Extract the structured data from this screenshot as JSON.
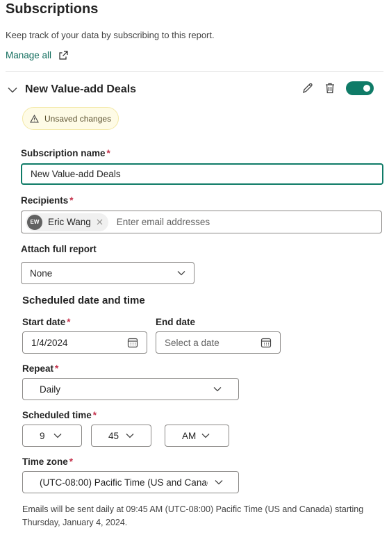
{
  "panel": {
    "title": "Subscriptions",
    "description": "Keep track of your data by subscribing to this report.",
    "manage_all": "Manage all"
  },
  "subscription": {
    "name_header": "New Value-add Deals",
    "enabled": true,
    "unsaved_badge": "Unsaved changes",
    "name_label": "Subscription name",
    "name_value": "New Value-add Deals",
    "recipients_label": "Recipients",
    "recipient": {
      "initials": "EW",
      "name": "Eric Wang"
    },
    "recipients_placeholder": "Enter email addresses",
    "attach_label": "Attach full report",
    "attach_value": "None",
    "schedule_heading": "Scheduled date and time",
    "start_label": "Start date",
    "start_value": "1/4/2024",
    "end_label": "End date",
    "end_placeholder": "Select a date",
    "repeat_label": "Repeat",
    "repeat_value": "Daily",
    "time_label": "Scheduled time",
    "hour": "9",
    "minute": "45",
    "ampm": "AM",
    "tz_label": "Time zone",
    "tz_value": "(UTC-08:00) Pacific Time (US and Canac",
    "footnote": "Emails will be sent daily at 09:45 AM (UTC-08:00) Pacific Time (US and Canada) starting Thursday, January 4, 2024."
  },
  "required_mark": "*",
  "colors": {
    "accent": "#0f7b67",
    "link": "#0f6c5c",
    "required": "#c4314b",
    "warning_bg": "#fefbe6"
  }
}
